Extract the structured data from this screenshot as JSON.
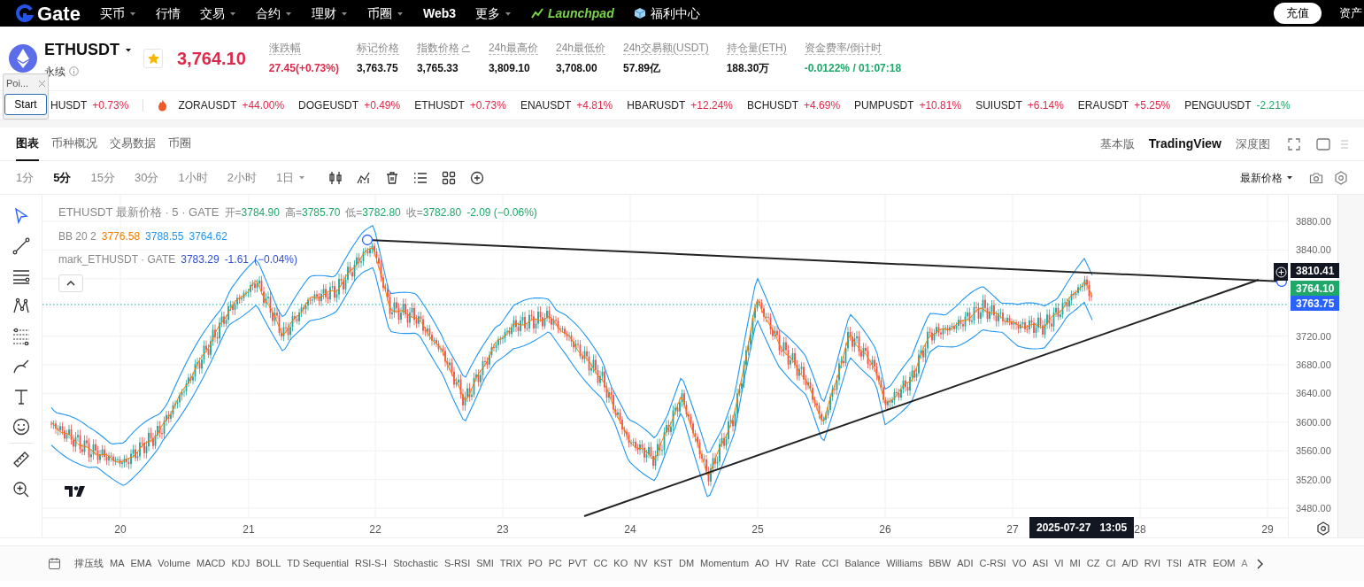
{
  "nav": {
    "logo_text": "Gate",
    "items": [
      {
        "label": "买币",
        "dropdown": true
      },
      {
        "label": "行情",
        "dropdown": false
      },
      {
        "label": "交易",
        "dropdown": true
      },
      {
        "label": "合约",
        "dropdown": true
      },
      {
        "label": "理财",
        "dropdown": true
      },
      {
        "label": "币圈",
        "dropdown": true
      },
      {
        "label": "Web3",
        "dropdown": false,
        "kind": "bold"
      },
      {
        "label": "更多",
        "dropdown": true
      },
      {
        "label": "Launchpad",
        "dropdown": false,
        "kind": "launchpad"
      },
      {
        "label": "福利中心",
        "dropdown": false,
        "kind": "gift"
      }
    ],
    "deposit_button": "充值",
    "assets": "资产"
  },
  "header": {
    "symbol": "ETHUSDT",
    "contract_type": "永续",
    "favorite": true,
    "price": "3,764.10",
    "stats": [
      {
        "label": "涨跌幅",
        "value": "27.45(+0.73%)",
        "color": "#e0294a"
      },
      {
        "label": "标记价格",
        "value": "3,763.75",
        "color": "#111111"
      },
      {
        "label": "指数价格",
        "value": "3,765.33",
        "color": "#111111",
        "link": true
      },
      {
        "label": "24h最高价",
        "value": "3,809.10",
        "color": "#111111"
      },
      {
        "label": "24h最低价",
        "value": "3,708.00",
        "color": "#111111"
      },
      {
        "label": "24h交易额(USDT)",
        "value": "57.89亿",
        "color": "#111111"
      },
      {
        "label": "持仓量(ETH)",
        "value": "188.30万",
        "color": "#111111"
      },
      {
        "label": "资金费率/倒计时",
        "value": "-0.0122% / 01:07:18",
        "color": "#20a86b"
      }
    ]
  },
  "popup": {
    "title": "Poi...",
    "button": "Start"
  },
  "tickers": [
    {
      "symbol": "HUSDT",
      "change": "+0.73%",
      "color": "#e0294a",
      "hot": false
    },
    {
      "symbol": "ZORAUSDT",
      "change": "+44.00%",
      "color": "#e0294a",
      "hot": true
    },
    {
      "symbol": "DOGEUSDT",
      "change": "+0.49%",
      "color": "#e0294a",
      "hot": false
    },
    {
      "symbol": "ETHUSDT",
      "change": "+0.73%",
      "color": "#e0294a",
      "hot": false
    },
    {
      "symbol": "ENAUSDT",
      "change": "+4.81%",
      "color": "#e0294a",
      "hot": false
    },
    {
      "symbol": "HBARUSDT",
      "change": "+12.24%",
      "color": "#e0294a",
      "hot": false
    },
    {
      "symbol": "BCHUSDT",
      "change": "+4.69%",
      "color": "#e0294a",
      "hot": false
    },
    {
      "symbol": "PUMPUSDT",
      "change": "+10.81%",
      "color": "#e0294a",
      "hot": false
    },
    {
      "symbol": "SUIUSDT",
      "change": "+6.14%",
      "color": "#e0294a",
      "hot": false
    },
    {
      "symbol": "ERAUSDT",
      "change": "+5.25%",
      "color": "#e0294a",
      "hot": false
    },
    {
      "symbol": "PENGUUSDT",
      "change": "-2.21%",
      "color": "#20a86b",
      "hot": false
    }
  ],
  "tabs": [
    {
      "label": "图表",
      "selected": true
    },
    {
      "label": "币种概况",
      "selected": false
    },
    {
      "label": "交易数据",
      "selected": false
    },
    {
      "label": "币圈",
      "selected": false
    }
  ],
  "views": [
    {
      "label": "基本版",
      "selected": false
    },
    {
      "label": "TradingView",
      "selected": true
    },
    {
      "label": "深度图",
      "selected": false
    }
  ],
  "intervals": [
    {
      "label": "1分",
      "selected": false
    },
    {
      "label": "5分",
      "selected": true
    },
    {
      "label": "15分",
      "selected": false
    },
    {
      "label": "30分",
      "selected": false
    },
    {
      "label": "1小时",
      "selected": false
    },
    {
      "label": "2小时",
      "selected": false
    },
    {
      "label": "1日",
      "selected": false,
      "dropdown": true
    }
  ],
  "price_type": "最新价格",
  "legend": {
    "title": "ETHUSDT 最新价格 · 5 · GATE",
    "ohlc": [
      {
        "label": "开=",
        "value": "3784.90"
      },
      {
        "label": "高=",
        "value": "3785.70"
      },
      {
        "label": "低=",
        "value": "3782.80"
      },
      {
        "label": "收=",
        "value": "3782.80"
      }
    ],
    "change": "-2.09 (−0.06%)",
    "bb": {
      "label": "BB 20 2",
      "values": [
        {
          "value": "3776.58",
          "color": "#f57c00"
        },
        {
          "value": "3788.55",
          "color": "#2196f3"
        },
        {
          "value": "3764.62",
          "color": "#2196f3"
        }
      ]
    },
    "mark": {
      "label": "mark_ETHUSDT · GATE",
      "values": [
        "3783.29",
        "-1.61",
        "(−0.04%)"
      ]
    }
  },
  "y_axis": [
    "3880.00",
    "3840.00",
    "3720.00",
    "3680.00",
    "3640.00",
    "3600.00",
    "3560.00",
    "3520.00",
    "3480.00"
  ],
  "price_labels": [
    {
      "value": "3810.41",
      "kind": "crosshair"
    },
    {
      "value": "3764.10",
      "kind": "last"
    },
    {
      "value": "3763.75",
      "kind": "mark"
    }
  ],
  "x_axis": [
    "20",
    "21",
    "22",
    "23",
    "24",
    "25",
    "26",
    "27",
    "28",
    "29"
  ],
  "crosshair_time": {
    "date": "2025-07-27",
    "time": "13:05"
  },
  "indicators": [
    "撑压线",
    "MA",
    "EMA",
    "Volume",
    "MACD",
    "KDJ",
    "BOLL",
    "TD Sequential",
    "RSI-S-I",
    "Stochastic",
    "S-RSI",
    "SMI",
    "TRIX",
    "PO",
    "PC",
    "PVT",
    "CC",
    "KO",
    "NV",
    "KST",
    "DM",
    "Momentum",
    "AO",
    "HV",
    "Rate",
    "CCI",
    "Balance",
    "Williams",
    "BBW",
    "ADI",
    "C-RSI",
    "VO",
    "ASI",
    "VI",
    "MI",
    "CZ",
    "CI",
    "A/D",
    "RVI",
    "TSI",
    "ATR",
    "EOM",
    "A"
  ]
}
